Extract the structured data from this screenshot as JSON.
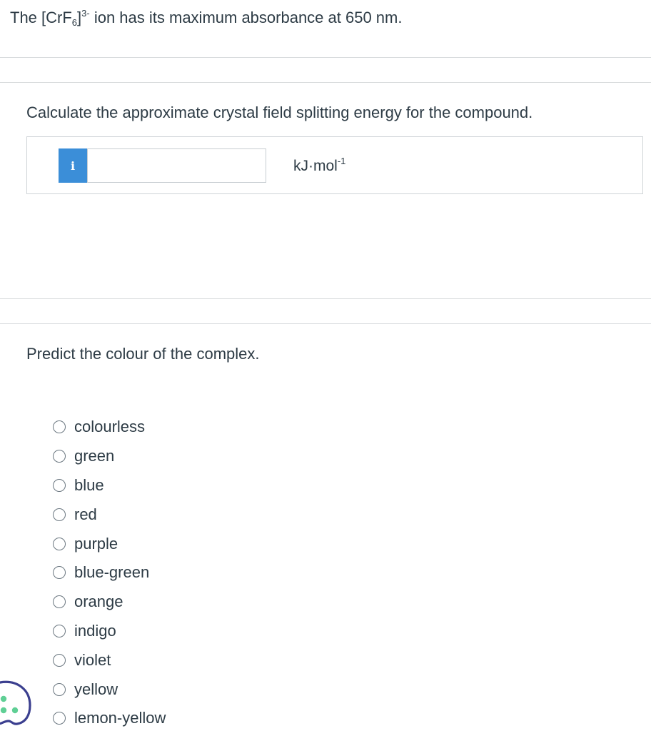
{
  "intro": {
    "prefix": "The [CrF",
    "subscript": "6",
    "bracket": "]",
    "superscript": "3-",
    "suffix": " ion has its maximum absorbance at 650 nm."
  },
  "part1": {
    "question": "Calculate the approximate crystal field splitting energy for the compound.",
    "info_label": "i",
    "input_value": "",
    "unit_base": "kJ·mol",
    "unit_exponent": "-1"
  },
  "part2": {
    "question": "Predict the colour of the complex.",
    "options": [
      "colourless",
      "green",
      "blue",
      "red",
      "purple",
      "blue-green",
      "orange",
      "indigo",
      "violet",
      "yellow",
      "lemon-yellow"
    ]
  },
  "colors": {
    "text": "#2d3b45",
    "info_button": "#3b8ed8",
    "divider": "#d7dadc",
    "widget_outline": "#3b3f8f",
    "widget_dots": "#5fcf95"
  }
}
